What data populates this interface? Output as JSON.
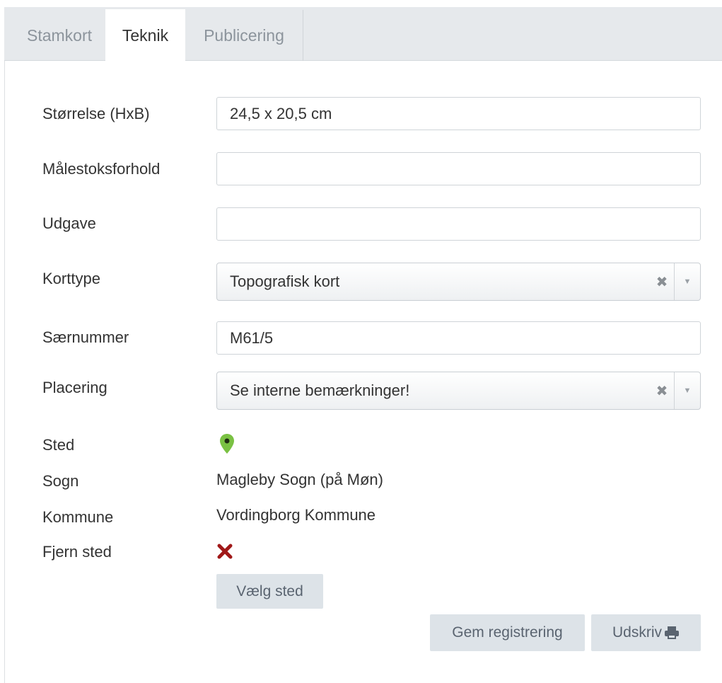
{
  "tabs": [
    {
      "label": "Stamkort",
      "active": false
    },
    {
      "label": "Teknik",
      "active": true
    },
    {
      "label": "Publicering",
      "active": false
    }
  ],
  "form": {
    "size": {
      "label": "Størrelse (HxB)",
      "value": "24,5 x 20,5 cm"
    },
    "scale": {
      "label": "Målestoksforhold",
      "value": ""
    },
    "edition": {
      "label": "Udgave",
      "value": ""
    },
    "map_type": {
      "label": "Korttype",
      "value": "Topografisk kort"
    },
    "special_number": {
      "label": "Særnummer",
      "value": "M61/5"
    },
    "location": {
      "label": "Placering",
      "value": "Se interne bemærkninger!"
    },
    "place": {
      "label": "Sted",
      "icon": "map-pin-icon",
      "icon_color": "#7ac143"
    },
    "parish": {
      "label": "Sogn",
      "value": "Magleby Sogn (på Møn)"
    },
    "municipality": {
      "label": "Kommune",
      "value": "Vordingborg Kommune"
    },
    "remove_place": {
      "label": "Fjern sted",
      "icon": "remove-x-icon",
      "icon_color": "#a01818"
    },
    "choose_place_button": "Vælg sted"
  },
  "actions": {
    "save": "Gem registrering",
    "print": "Udskriv",
    "print_icon": "printer-icon"
  },
  "colors": {
    "tabbar_bg": "#e6e9ec",
    "button_bg": "#dde3e8"
  }
}
